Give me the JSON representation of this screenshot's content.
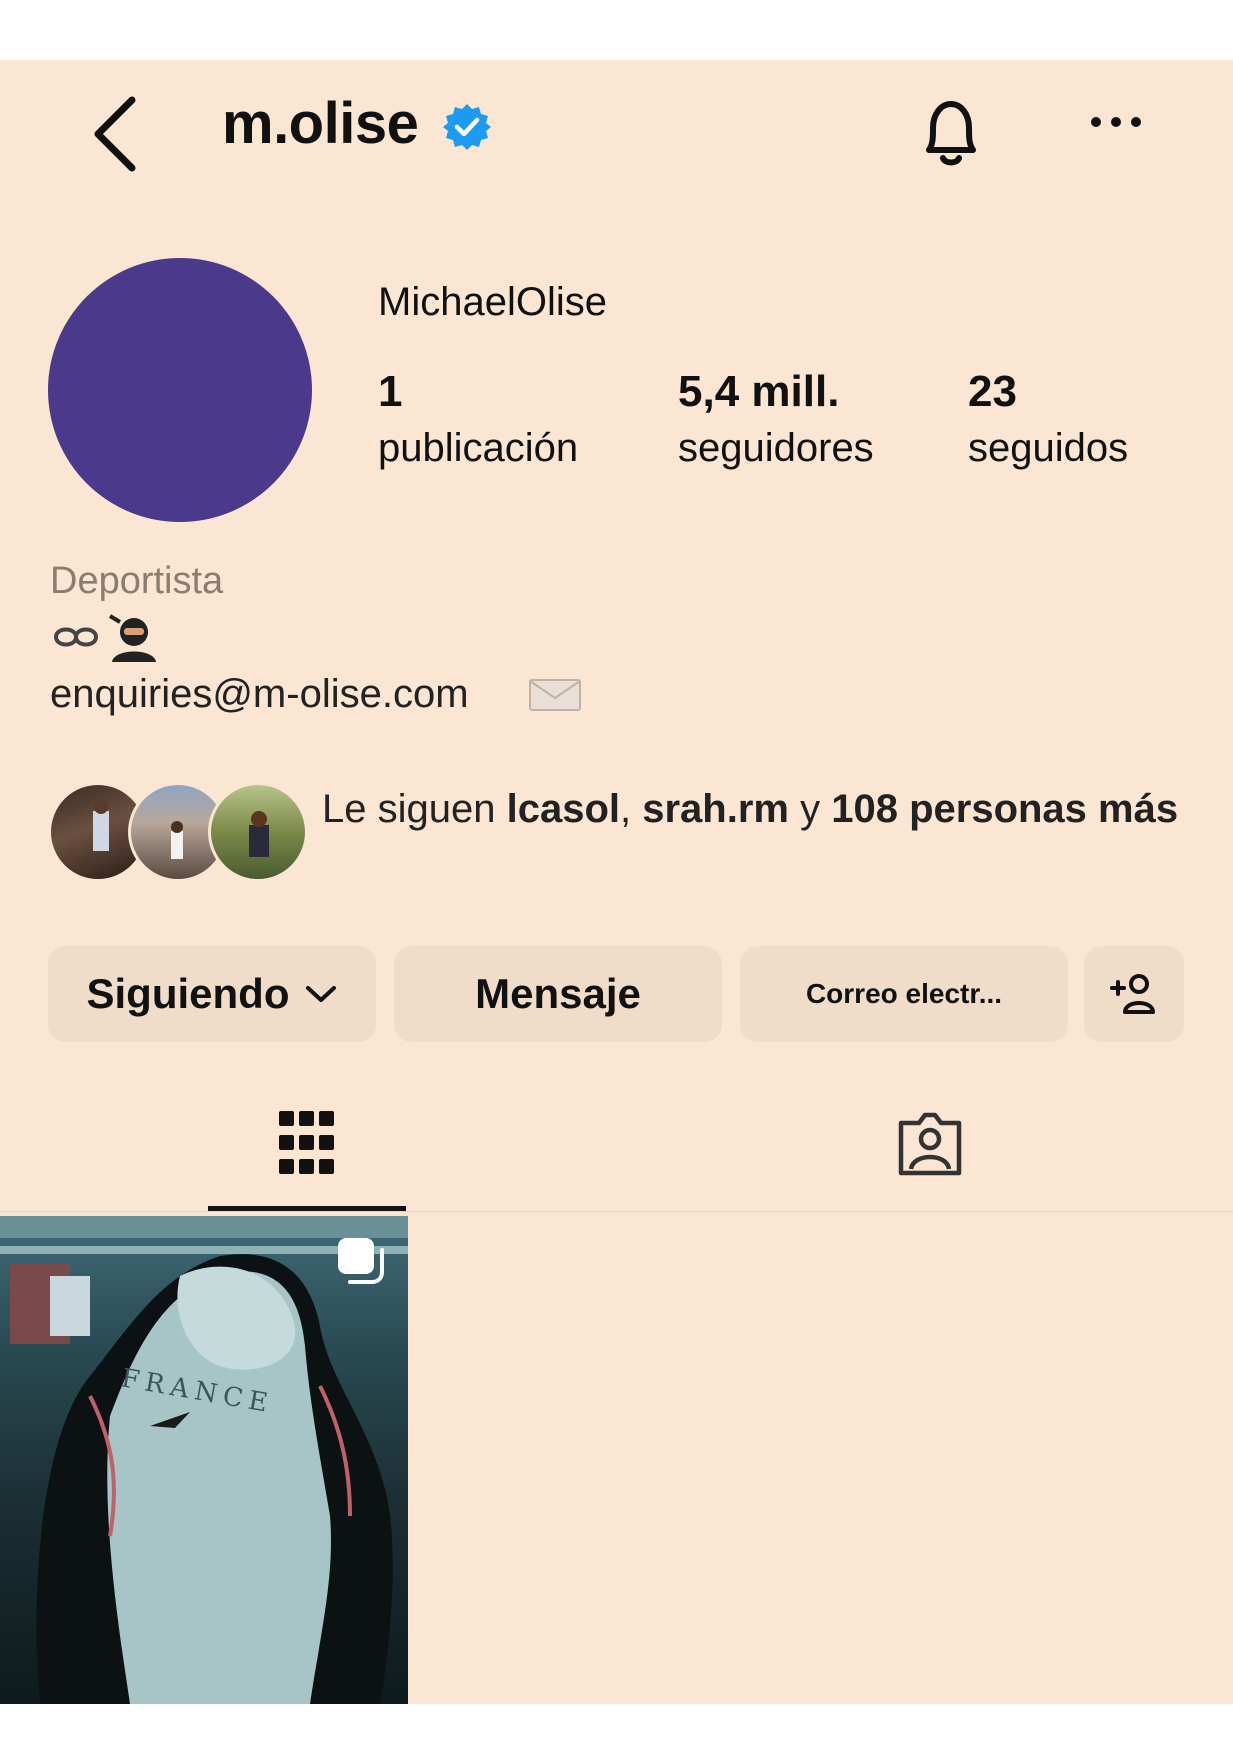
{
  "header": {
    "username": "m.olise"
  },
  "profile": {
    "display_name": "MichaelOlise",
    "stats": [
      {
        "value": "1",
        "label": "publicación"
      },
      {
        "value": "5,4 mill.",
        "label": "seguidores"
      },
      {
        "value": "23",
        "label": "seguidos"
      }
    ],
    "category": "Deportista",
    "email": "enquiries@m-olise.com"
  },
  "followed_by": {
    "prefix": "Le siguen ",
    "user1": "lcasol",
    "sep1": ", ",
    "user2": "srah.rm",
    "sep2": " y ",
    "rest": "108 personas más"
  },
  "actions": {
    "following_label": "Siguiendo",
    "message_label": "Mensaje",
    "email_label": "Correo electr..."
  },
  "colors": {
    "background": "#fae6d2",
    "button": "#f0ddc9",
    "avatar": "#4b3a8c",
    "verified": "#1d9bf0"
  }
}
